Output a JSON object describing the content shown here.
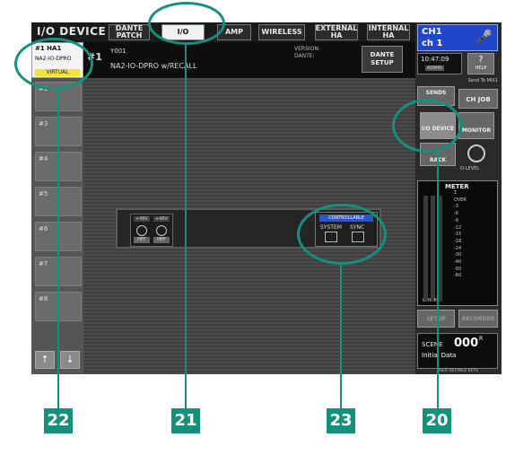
{
  "header": {
    "screen_title": "I/O DEVICE",
    "tabs": [
      {
        "label": "DANTE PATCH"
      },
      {
        "label": "I/O"
      },
      {
        "label": "AMP"
      },
      {
        "label": "WIRELESS"
      },
      {
        "label": "EXTERNAL HA"
      },
      {
        "label": "INTERNAL HA"
      }
    ],
    "active_tab": "I/O"
  },
  "device_header": {
    "slot_label": "#1 HA1",
    "model": "NA2-IO-DPRO",
    "status_badge": "VIRTUAL",
    "row_number": "#1",
    "id": "Y001",
    "name": "NA2-IO-DPRO w/RECALL",
    "version_text": "VERSION:\nDANTE:",
    "dante_setup_label": "DANTE SETUP"
  },
  "slot_list": {
    "items": [
      "#2",
      "#3",
      "#4",
      "#5",
      "#6",
      "#7",
      "#8"
    ]
  },
  "device_panel": {
    "phantom_labels": [
      "+48V",
      "+48V"
    ],
    "hpf_labels": [
      "HPF",
      "HPF"
    ],
    "controllable_label": "CONTROLLABLE",
    "system_label": "SYSTEM",
    "sync_label": "SYNC"
  },
  "right_panel": {
    "channel_line1": "CH1",
    "channel_line2": "ch 1",
    "time": "10:47:09",
    "user_label": "ADMIN",
    "help_label": "?",
    "help_sub": "HELP",
    "send_to_mix": "Send To MIX1",
    "sends_label": "SENDS",
    "ch_job_label": "CH JOB",
    "io_device_label": "I/O DEVICE",
    "monitor_label": "MONITOR",
    "rack_label": "RACK",
    "level_label": "O-LEVEL",
    "meter_title": "METER",
    "meter_scale": [
      "Σ",
      "OVER",
      "-3",
      "-6",
      "-9",
      "-12",
      "-15",
      "-18",
      "-24",
      "-30",
      "-40",
      "-50",
      "-60"
    ],
    "meter_channels": [
      "L",
      "R",
      "M"
    ],
    "setup_label": "SETUP",
    "recorder_label": "RECORDER",
    "scene_label": "SCENE",
    "scene_number": "000",
    "scene_flag": "R",
    "scene_name": "Initial Data",
    "user_defined_keys": "USER DEFINED KEYS"
  },
  "callouts": [
    "22",
    "21",
    "23",
    "20"
  ],
  "colors": {
    "callout": "#16907b",
    "channel_box": "#2146c9",
    "virtual_badge": "#f3e332"
  }
}
